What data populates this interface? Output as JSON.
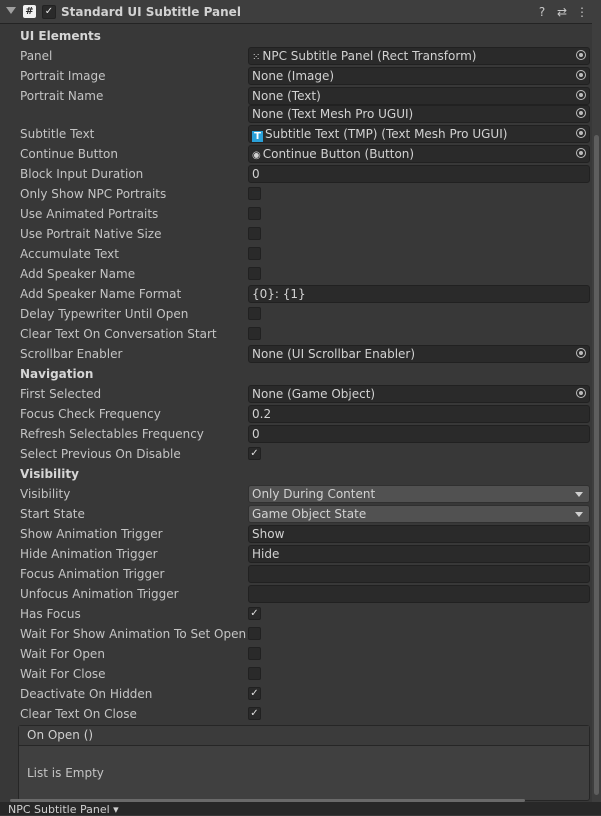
{
  "component": {
    "title": "Standard UI Subtitle Panel",
    "enabled": true,
    "icons": [
      "component-script-icon",
      "help-icon",
      "presets-icon",
      "kebab-menu-icon"
    ]
  },
  "sections": {
    "ui_elements": "UI Elements",
    "navigation": "Navigation",
    "visibility": "Visibility"
  },
  "fields": {
    "panel": {
      "label": "Panel",
      "value": "NPC Subtitle Panel (Rect Transform)"
    },
    "portrait_image": {
      "label": "Portrait Image",
      "value": "None (Image)"
    },
    "portrait_name": {
      "label": "Portrait Name",
      "value": "None (Text)",
      "value2": "None (Text Mesh Pro UGUI)"
    },
    "subtitle_text": {
      "label": "Subtitle Text",
      "value": "Subtitle Text (TMP) (Text Mesh Pro UGUI)"
    },
    "continue_button": {
      "label": "Continue Button",
      "value": "Continue Button (Button)"
    },
    "block_input_duration": {
      "label": "Block Input Duration",
      "value": "0"
    },
    "only_show_npc_portraits": {
      "label": "Only Show NPC Portraits",
      "checked": false
    },
    "use_animated_portraits": {
      "label": "Use Animated Portraits",
      "checked": false
    },
    "use_portrait_native_size": {
      "label": "Use Portrait Native Size",
      "checked": false
    },
    "accumulate_text": {
      "label": "Accumulate Text",
      "checked": false
    },
    "add_speaker_name": {
      "label": "Add Speaker Name",
      "checked": false
    },
    "add_speaker_name_format": {
      "label": "Add Speaker Name Format",
      "value": "{0}: {1}"
    },
    "delay_typewriter_until_open": {
      "label": "Delay Typewriter Until Open",
      "checked": false
    },
    "clear_text_on_conversation_start": {
      "label": "Clear Text On Conversation Start",
      "checked": false
    },
    "scrollbar_enabler": {
      "label": "Scrollbar Enabler",
      "value": "None (UI Scrollbar Enabler)"
    },
    "first_selected": {
      "label": "First Selected",
      "value": "None (Game Object)"
    },
    "focus_check_frequency": {
      "label": "Focus Check Frequency",
      "value": "0.2"
    },
    "refresh_selectables_frequency": {
      "label": "Refresh Selectables Frequency",
      "value": "0"
    },
    "select_previous_on_disable": {
      "label": "Select Previous On Disable",
      "checked": true
    },
    "visibility": {
      "label": "Visibility",
      "value": "Only During Content"
    },
    "start_state": {
      "label": "Start State",
      "value": "Game Object State"
    },
    "show_animation_trigger": {
      "label": "Show Animation Trigger",
      "value": "Show"
    },
    "hide_animation_trigger": {
      "label": "Hide Animation Trigger",
      "value": "Hide"
    },
    "focus_animation_trigger": {
      "label": "Focus Animation Trigger",
      "value": ""
    },
    "unfocus_animation_trigger": {
      "label": "Unfocus Animation Trigger",
      "value": ""
    },
    "has_focus": {
      "label": "Has Focus",
      "checked": true
    },
    "wait_for_show_animation": {
      "label": "Wait For Show Animation To Set Open",
      "checked": false
    },
    "wait_for_open": {
      "label": "Wait For Open",
      "checked": false
    },
    "wait_for_close": {
      "label": "Wait For Close",
      "checked": false
    },
    "deactivate_on_hidden": {
      "label": "Deactivate On Hidden",
      "checked": true
    },
    "clear_text_on_close": {
      "label": "Clear Text On Close",
      "checked": true
    }
  },
  "on_open_event": {
    "header": "On Open ()",
    "empty_text": "List is Empty"
  },
  "footer": {
    "object_name": "NPC Subtitle Panel ▾"
  },
  "checkmark": "✓"
}
